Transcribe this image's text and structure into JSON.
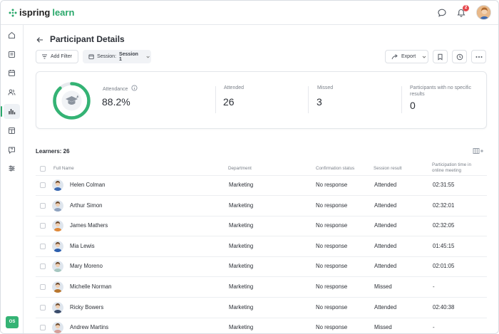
{
  "app": {
    "brand_word1": "ispring",
    "brand_word2": "learn",
    "notification_count": "2",
    "user_initials": "OS"
  },
  "page": {
    "title": "Participant Details"
  },
  "toolbar": {
    "add_filter": "Add Filter",
    "session_label": "Session:",
    "session_value": "Session 1",
    "export": "Export"
  },
  "stats": {
    "attendance_label": "Attendance",
    "attendance_value": "88.2%",
    "attendance_fraction": 0.882,
    "attended_label": "Attended",
    "attended_value": "26",
    "missed_label": "Missed",
    "missed_value": "3",
    "no_results_label_line1": "Participants with no specific",
    "no_results_label_line2": "results",
    "no_results_value": "0"
  },
  "table": {
    "learners_label": "Learners: 26",
    "headers": {
      "full_name": "Full Name",
      "department": "Department",
      "confirmation": "Confirmation status",
      "result": "Session result",
      "time_line1": "Participation time in",
      "time_line2": "online meeting"
    },
    "rows": [
      {
        "name": "Helen Colman",
        "department": "Marketing",
        "confirmation": "No response",
        "result": "Attended",
        "time": "02:31:55",
        "avatar_color": "#3d6bb3"
      },
      {
        "name": "Arthur Simon",
        "department": "Marketing",
        "confirmation": "No response",
        "result": "Attended",
        "time": "02:32:01",
        "avatar_color": "#8fa3c0"
      },
      {
        "name": "James Mathers",
        "department": "Marketing",
        "confirmation": "No response",
        "result": "Attended",
        "time": "02:32:05",
        "avatar_color": "#e08a3a"
      },
      {
        "name": "Mia Lewis",
        "department": "Marketing",
        "confirmation": "No response",
        "result": "Attended",
        "time": "01:45:15",
        "avatar_color": "#2d5fae"
      },
      {
        "name": "Mary Moreno",
        "department": "Marketing",
        "confirmation": "No response",
        "result": "Attended",
        "time": "02:01:05",
        "avatar_color": "#a6c7c0"
      },
      {
        "name": "Michelle Norman",
        "department": "Marketing",
        "confirmation": "No response",
        "result": "Missed",
        "time": "-",
        "avatar_color": "#b9772f"
      },
      {
        "name": "Ricky Bowers",
        "department": "Marketing",
        "confirmation": "No response",
        "result": "Attended",
        "time": "02:40:38",
        "avatar_color": "#3a4c6b"
      },
      {
        "name": "Andrew Martins",
        "department": "Marketing",
        "confirmation": "No response",
        "result": "Missed",
        "time": "-",
        "avatar_color": "#d5a09a"
      }
    ]
  },
  "colors": {
    "accent": "#2aa86b",
    "ring_track": "#e7eaee",
    "badge": "#e5484d"
  },
  "icons": {
    "sidebar": [
      "home-icon",
      "courses-icon",
      "calendar-icon",
      "users-icon",
      "reports-icon",
      "content-icon",
      "help-icon",
      "settings-icon"
    ],
    "top": [
      "chat-icon",
      "bell-icon"
    ]
  }
}
